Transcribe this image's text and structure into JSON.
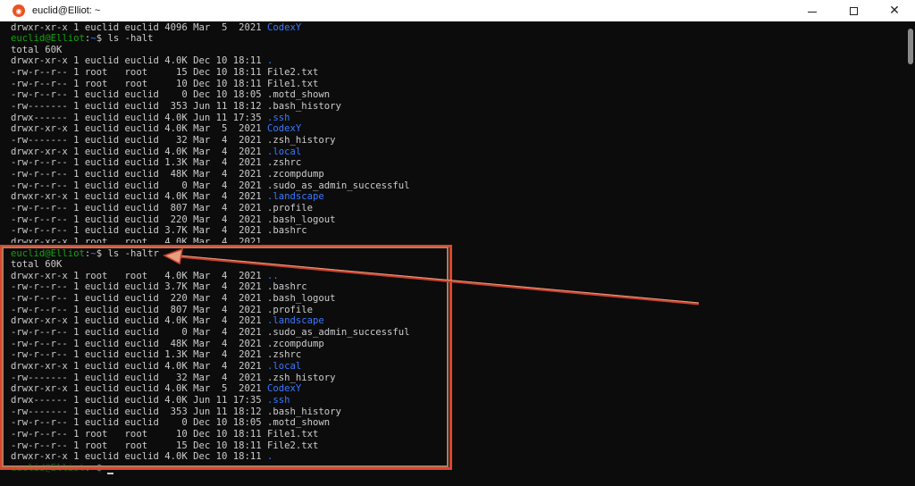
{
  "window": {
    "title": "euclid@Elliot: ~",
    "app_icon": "ubuntu-icon",
    "controls": {
      "minimize": "minimize-icon",
      "maximize": "maximize-icon",
      "close": "✕"
    }
  },
  "colors": {
    "prompt": "#13a10e",
    "directory": "#3b78ff",
    "text": "#cccccc",
    "background": "#0c0c0c",
    "annotation_red": "#d9472f",
    "annotation_tan": "#b8785a"
  },
  "prompt": {
    "user_host": "euclid@Elliot",
    "path": "~",
    "symbol": "$"
  },
  "commands": {
    "first": "ls -halt",
    "second": "ls -haltr"
  },
  "totals": {
    "first": "total 60K",
    "second": "total 60K"
  },
  "top_partial_line": {
    "prefix": "drwxr-xr-x 1 euclid euclid 4096 Mar  5  2021 ",
    "name": "CodexY"
  },
  "listing_halt": [
    {
      "prefix": "drwxr-xr-x 1 euclid euclid 4.0K Dec 10 18:11 ",
      "name": ".",
      "dir": true
    },
    {
      "prefix": "-rw-r--r-- 1 root   root     15 Dec 10 18:11 ",
      "name": "File2.txt",
      "dir": false
    },
    {
      "prefix": "-rw-r--r-- 1 root   root     10 Dec 10 18:11 ",
      "name": "File1.txt",
      "dir": false
    },
    {
      "prefix": "-rw-r--r-- 1 euclid euclid    0 Dec 10 18:05 ",
      "name": ".motd_shown",
      "dir": false
    },
    {
      "prefix": "-rw------- 1 euclid euclid  353 Jun 11 18:12 ",
      "name": ".bash_history",
      "dir": false
    },
    {
      "prefix": "drwx------ 1 euclid euclid 4.0K Jun 11 17:35 ",
      "name": ".ssh",
      "dir": true
    },
    {
      "prefix": "drwxr-xr-x 1 euclid euclid 4.0K Mar  5  2021 ",
      "name": "CodexY",
      "dir": true
    },
    {
      "prefix": "-rw------- 1 euclid euclid   32 Mar  4  2021 ",
      "name": ".zsh_history",
      "dir": false
    },
    {
      "prefix": "drwxr-xr-x 1 euclid euclid 4.0K Mar  4  2021 ",
      "name": ".local",
      "dir": true
    },
    {
      "prefix": "-rw-r--r-- 1 euclid euclid 1.3K Mar  4  2021 ",
      "name": ".zshrc",
      "dir": false
    },
    {
      "prefix": "-rw-r--r-- 1 euclid euclid  48K Mar  4  2021 ",
      "name": ".zcompdump",
      "dir": false
    },
    {
      "prefix": "-rw-r--r-- 1 euclid euclid    0 Mar  4  2021 ",
      "name": ".sudo_as_admin_successful",
      "dir": false
    },
    {
      "prefix": "drwxr-xr-x 1 euclid euclid 4.0K Mar  4  2021 ",
      "name": ".landscape",
      "dir": true
    },
    {
      "prefix": "-rw-r--r-- 1 euclid euclid  807 Mar  4  2021 ",
      "name": ".profile",
      "dir": false
    },
    {
      "prefix": "-rw-r--r-- 1 euclid euclid  220 Mar  4  2021 ",
      "name": ".bash_logout",
      "dir": false
    },
    {
      "prefix": "-rw-r--r-- 1 euclid euclid 3.7K Mar  4  2021 ",
      "name": ".bashrc",
      "dir": false
    },
    {
      "prefix": "drwxr-xr-x 1 root   root   4.0K Mar  4  2021 ",
      "name": "..",
      "dir": true
    }
  ],
  "listing_haltr": [
    {
      "prefix": "drwxr-xr-x 1 root   root   4.0K Mar  4  2021 ",
      "name": "..",
      "dir": true
    },
    {
      "prefix": "-rw-r--r-- 1 euclid euclid 3.7K Mar  4  2021 ",
      "name": ".bashrc",
      "dir": false
    },
    {
      "prefix": "-rw-r--r-- 1 euclid euclid  220 Mar  4  2021 ",
      "name": ".bash_logout",
      "dir": false
    },
    {
      "prefix": "-rw-r--r-- 1 euclid euclid  807 Mar  4  2021 ",
      "name": ".profile",
      "dir": false
    },
    {
      "prefix": "drwxr-xr-x 1 euclid euclid 4.0K Mar  4  2021 ",
      "name": ".landscape",
      "dir": true
    },
    {
      "prefix": "-rw-r--r-- 1 euclid euclid    0 Mar  4  2021 ",
      "name": ".sudo_as_admin_successful",
      "dir": false
    },
    {
      "prefix": "-rw-r--r-- 1 euclid euclid  48K Mar  4  2021 ",
      "name": ".zcompdump",
      "dir": false
    },
    {
      "prefix": "-rw-r--r-- 1 euclid euclid 1.3K Mar  4  2021 ",
      "name": ".zshrc",
      "dir": false
    },
    {
      "prefix": "drwxr-xr-x 1 euclid euclid 4.0K Mar  4  2021 ",
      "name": ".local",
      "dir": true
    },
    {
      "prefix": "-rw------- 1 euclid euclid   32 Mar  4  2021 ",
      "name": ".zsh_history",
      "dir": false
    },
    {
      "prefix": "drwxr-xr-x 1 euclid euclid 4.0K Mar  5  2021 ",
      "name": "CodexY",
      "dir": true
    },
    {
      "prefix": "drwx------ 1 euclid euclid 4.0K Jun 11 17:35 ",
      "name": ".ssh",
      "dir": true
    },
    {
      "prefix": "-rw------- 1 euclid euclid  353 Jun 11 18:12 ",
      "name": ".bash_history",
      "dir": false
    },
    {
      "prefix": "-rw-r--r-- 1 euclid euclid    0 Dec 10 18:05 ",
      "name": ".motd_shown",
      "dir": false
    },
    {
      "prefix": "-rw-r--r-- 1 root   root     10 Dec 10 18:11 ",
      "name": "File1.txt",
      "dir": false
    },
    {
      "prefix": "-rw-r--r-- 1 root   root     15 Dec 10 18:11 ",
      "name": "File2.txt",
      "dir": false
    },
    {
      "prefix": "drwxr-xr-x 1 euclid euclid 4.0K Dec 10 18:11 ",
      "name": ".",
      "dir": true
    }
  ]
}
